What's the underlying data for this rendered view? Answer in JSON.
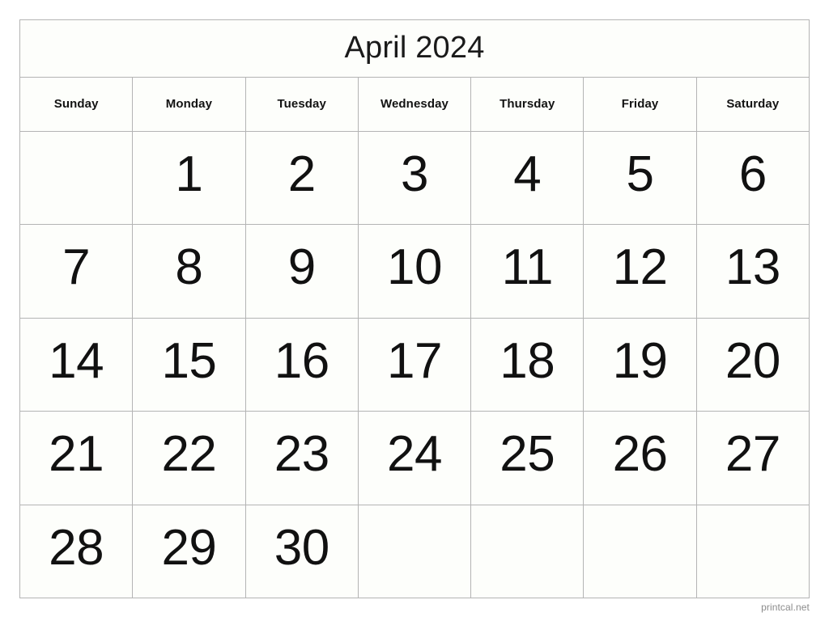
{
  "calendar": {
    "title": "April 2024",
    "month": "April",
    "year": "2024",
    "weekday_headers": [
      "Sunday",
      "Monday",
      "Tuesday",
      "Wednesday",
      "Thursday",
      "Friday",
      "Saturday"
    ],
    "weeks": [
      [
        "",
        "1",
        "2",
        "3",
        "4",
        "5",
        "6"
      ],
      [
        "7",
        "8",
        "9",
        "10",
        "11",
        "12",
        "13"
      ],
      [
        "14",
        "15",
        "16",
        "17",
        "18",
        "19",
        "20"
      ],
      [
        "21",
        "22",
        "23",
        "24",
        "25",
        "26",
        "27"
      ],
      [
        "28",
        "29",
        "30",
        "",
        "",
        "",
        ""
      ]
    ]
  },
  "footer": {
    "source_label": "printcal.net"
  },
  "colors": {
    "page_background": "#ffffff",
    "cell_background": "#fdfefb",
    "border": "#b4b4b4",
    "title_text": "#1a1a1a",
    "day_text": "#111111",
    "header_text": "#131313",
    "footer_text": "#8c8c8c"
  }
}
